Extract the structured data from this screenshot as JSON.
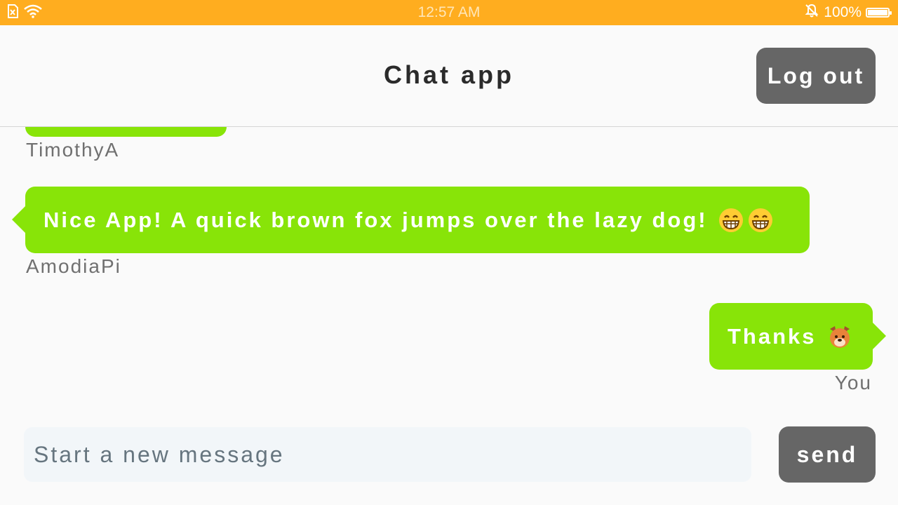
{
  "status_bar": {
    "time": "12:57 AM",
    "battery": "100%",
    "icons": [
      "no-sim-icon",
      "wifi-icon",
      "mute-icon",
      "battery-icon"
    ]
  },
  "header": {
    "title": "Chat app",
    "logout_label": "Log out"
  },
  "messages": [
    {
      "text": "",
      "sender": "TimothyA",
      "side": "left",
      "partial": true
    },
    {
      "text": "Nice App! A quick brown fox jumps over the lazy dog!",
      "emojis": [
        "grinning-face-emoji",
        "grinning-face-emoji"
      ],
      "sender": "AmodiaPi",
      "side": "left"
    },
    {
      "text": "Thanks",
      "emojis": [
        "dog-face-emoji"
      ],
      "sender": "You",
      "side": "right"
    }
  ],
  "composer": {
    "placeholder": "Start a new message",
    "value": "",
    "send_label": "send"
  },
  "colors": {
    "status_bar": "#ffad1f",
    "bubble": "#88e408",
    "button": "#666666"
  }
}
